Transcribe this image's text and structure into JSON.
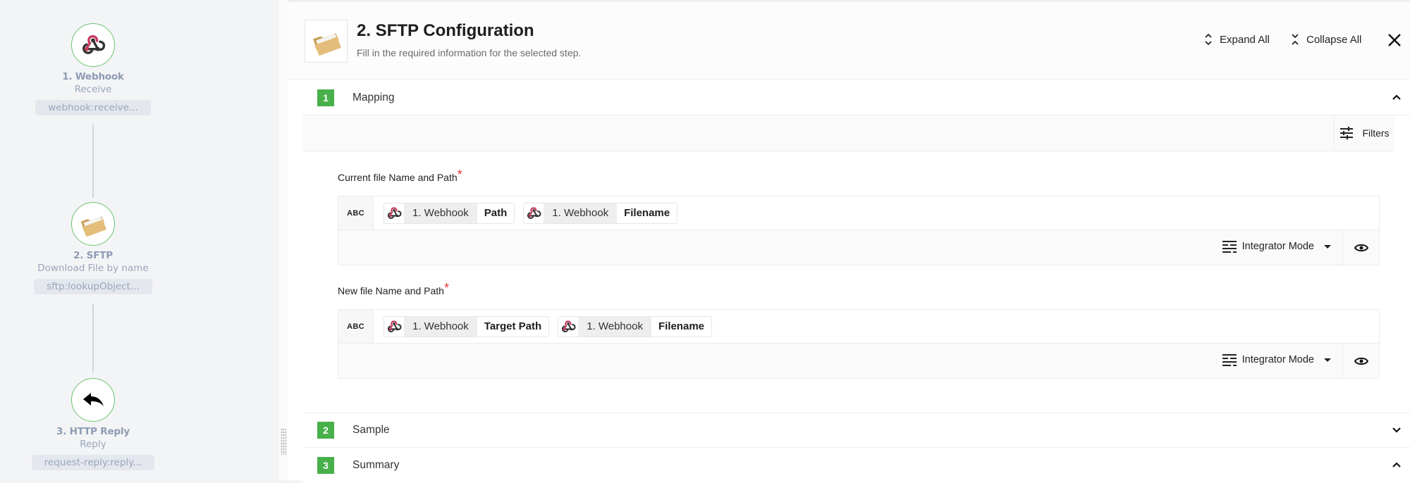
{
  "flow": {
    "steps": [
      {
        "title": "1. Webhook",
        "subtitle": "Receive",
        "code": "webhook:receive...",
        "icon": "webhook-icon"
      },
      {
        "title": "2. SFTP",
        "subtitle": "Download File by name",
        "code": "sftp:lookupObject...",
        "icon": "folder-icon"
      },
      {
        "title": "3. HTTP Reply",
        "subtitle": "Reply",
        "code": "request-reply:reply...",
        "icon": "reply-arrow-icon"
      }
    ]
  },
  "header": {
    "title": "2. SFTP Configuration",
    "subtitle": "Fill in the required information for the selected step.",
    "expand_all": "Expand All",
    "collapse_all": "Collapse All"
  },
  "sections": [
    {
      "number": "1",
      "label": "Mapping",
      "state": "expanded"
    },
    {
      "number": "2",
      "label": "Sample",
      "state": "collapsed"
    },
    {
      "number": "3",
      "label": "Summary",
      "state": "expanded"
    }
  ],
  "mapping": {
    "filters_label": "Filters",
    "fields": [
      {
        "label": "Current file Name and Path",
        "required": "*",
        "type_badge": "ABC",
        "tokens": [
          {
            "step": "1. Webhook",
            "field": "Path"
          },
          {
            "step": "1. Webhook",
            "field": "Filename"
          }
        ],
        "mode": "Integrator Mode"
      },
      {
        "label": "New file Name and Path",
        "required": "*",
        "type_badge": "ABC",
        "tokens": [
          {
            "step": "1. Webhook",
            "field": "Target Path"
          },
          {
            "step": "1. Webhook",
            "field": "Filename"
          }
        ],
        "mode": "Integrator Mode"
      }
    ]
  },
  "colors": {
    "accent_green": "#47b04b",
    "node_border": "#6cc36f",
    "webhook_red": "#c73a5c",
    "required_red": "#e53935"
  }
}
